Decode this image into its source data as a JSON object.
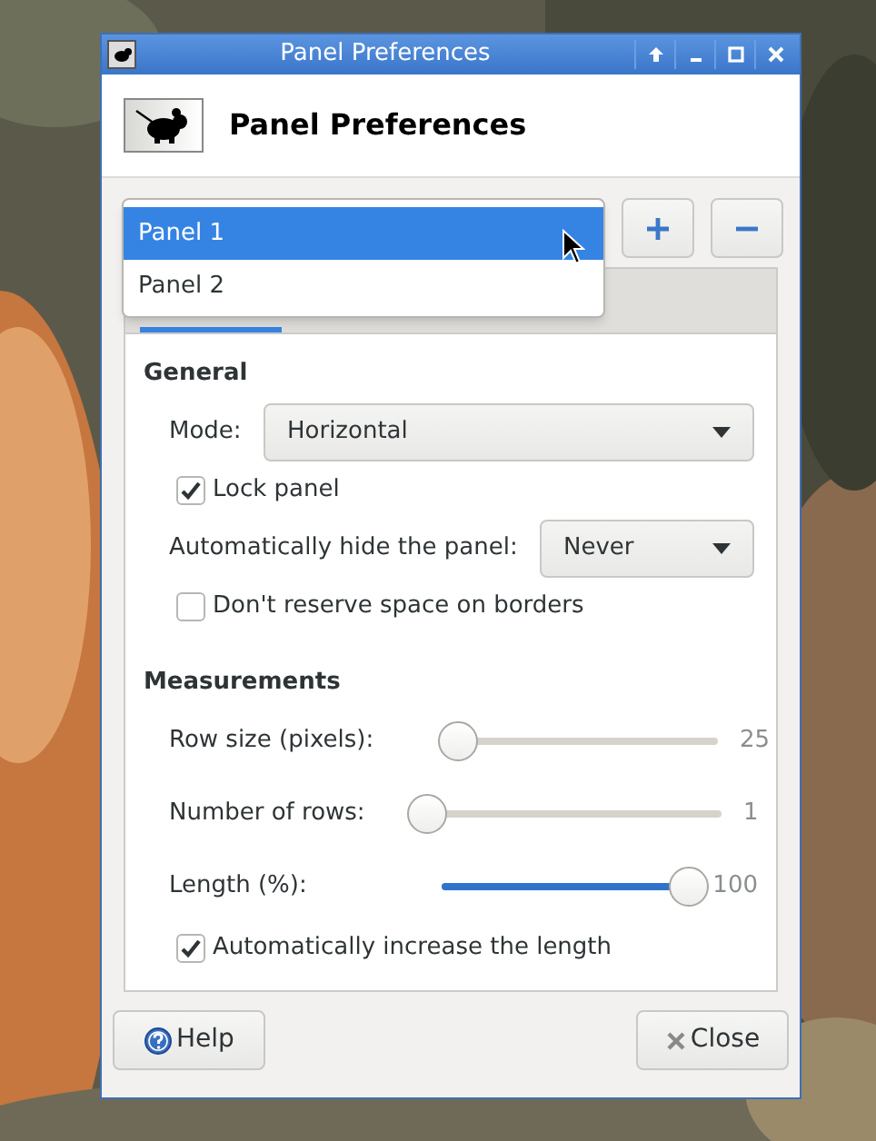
{
  "window": {
    "title": "Panel Preferences"
  },
  "header": {
    "title": "Panel Preferences"
  },
  "panel_selector": {
    "options": [
      {
        "label": "Panel 1",
        "selected": true
      },
      {
        "label": "Panel 2",
        "selected": false
      }
    ]
  },
  "panel_buttons": [
    {
      "kind": "add"
    },
    {
      "kind": "remove"
    }
  ],
  "general": {
    "title": "General",
    "mode": {
      "label": "Mode:",
      "value": "Horizontal"
    },
    "lock_panel": {
      "label": "Lock panel",
      "checked": true
    },
    "autohide": {
      "label": "Automatically hide the panel:",
      "value": "Never"
    },
    "dont_reserve": {
      "label": "Don't reserve space on borders",
      "checked": false
    }
  },
  "measurements": {
    "title": "Measurements",
    "sliders": [
      {
        "label": "Row size (pixels):",
        "level": 0.02,
        "reading": "25"
      },
      {
        "label": "Number of rows:",
        "level": 0,
        "reading": "1"
      },
      {
        "label": "Length (%):",
        "level": 1,
        "reading": "100"
      }
    ],
    "auto_increase": {
      "label": "Automatically increase the length",
      "checked": true
    }
  },
  "buttons": [
    {
      "kind": "help",
      "label": "Help"
    },
    {
      "kind": "close",
      "label": "Close"
    }
  ]
}
